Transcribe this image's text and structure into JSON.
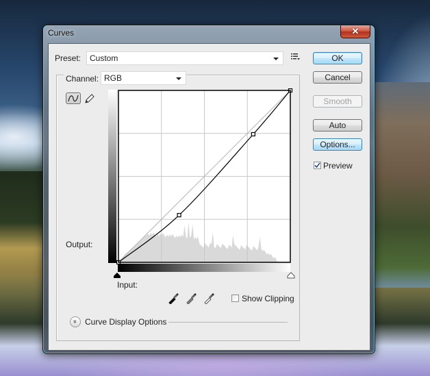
{
  "window": {
    "title": "Curves",
    "close_glyph": "✕"
  },
  "preset": {
    "label": "Preset:",
    "value": "Custom",
    "menu_icon": "preset-options-icon"
  },
  "channel": {
    "label": "Channel:",
    "value": "RGB"
  },
  "tools": {
    "curve_tool": "curve-point-icon",
    "pencil_tool": "pencil-icon"
  },
  "graph": {
    "output_label": "Output:",
    "input_label": "Input:",
    "range": [
      0,
      255
    ],
    "grid_divisions": 4,
    "control_points": [
      {
        "input": 0,
        "output": 0
      },
      {
        "input": 90,
        "output": 70
      },
      {
        "input": 200,
        "output": 190
      },
      {
        "input": 255,
        "output": 255
      }
    ],
    "colors": {
      "curve": "#000000",
      "baseline": "#b4b4b4",
      "grid": "#c8c8c8",
      "histogram": "#d9d9d9"
    }
  },
  "eyedroppers": [
    {
      "name": "black-point-eyedropper"
    },
    {
      "name": "gray-point-eyedropper"
    },
    {
      "name": "white-point-eyedropper"
    }
  ],
  "show_clipping": {
    "label": "Show Clipping",
    "checked": false
  },
  "curve_display_options": {
    "label": "Curve Display Options",
    "expander_glyph": "»"
  },
  "buttons": {
    "ok": "OK",
    "cancel": "Cancel",
    "smooth": "Smooth",
    "auto": "Auto",
    "options": "Options..."
  },
  "preview": {
    "label": "Preview",
    "checked": true
  }
}
